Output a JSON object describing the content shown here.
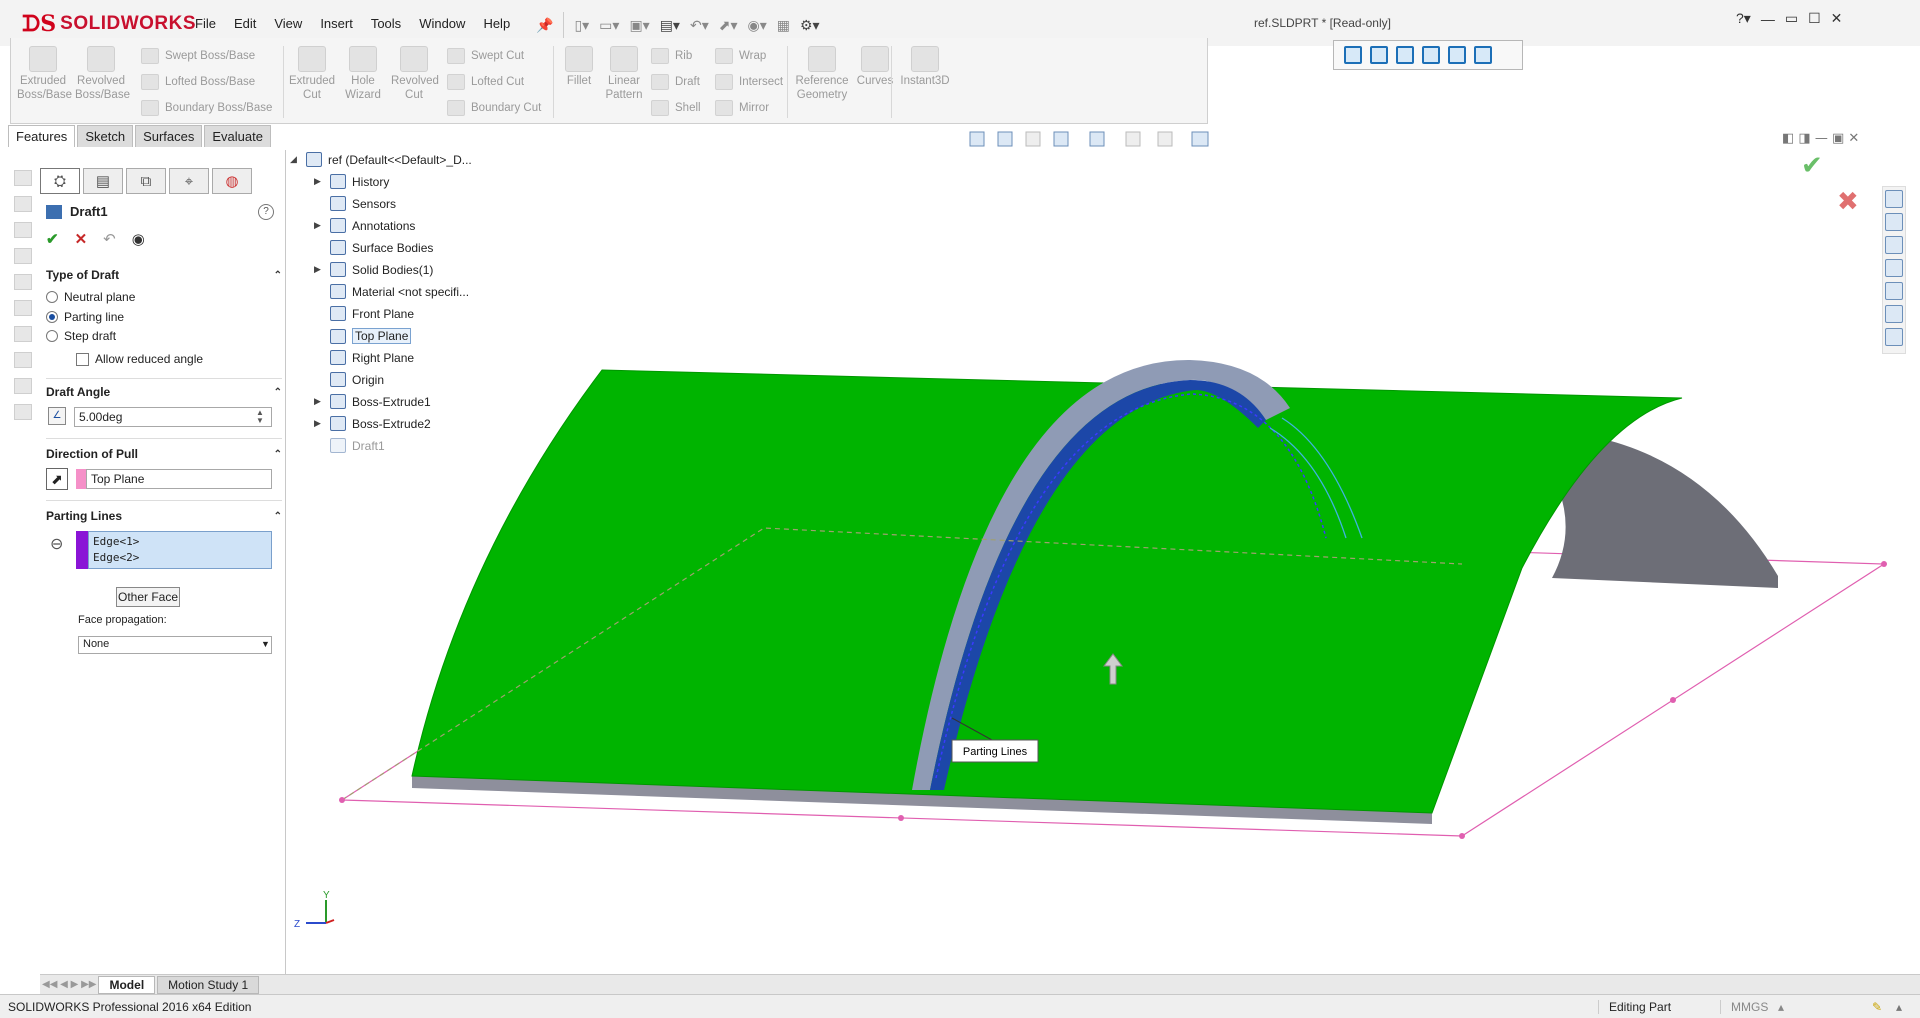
{
  "app": {
    "brand": "SOLIDWORKS",
    "doc_title": "ref.SLDPRT * [Read-only]"
  },
  "menu": [
    "File",
    "Edit",
    "View",
    "Insert",
    "Tools",
    "Window",
    "Help"
  ],
  "ribbon": {
    "buttons": [
      "Extruded Boss/Base",
      "Revolved Boss/Base",
      "Extruded Cut",
      "Hole Wizard",
      "Revolved Cut",
      "Fillet",
      "Linear Pattern",
      "Reference Geometry",
      "Curves",
      "Instant3D"
    ],
    "small": [
      "Swept Boss/Base",
      "Lofted Boss/Base",
      "Boundary Boss/Base",
      "Swept Cut",
      "Lofted Cut",
      "Boundary Cut",
      "Rib",
      "Draft",
      "Shell",
      "Wrap",
      "Intersect",
      "Mirror"
    ]
  },
  "cm_tabs": [
    "Features",
    "Sketch",
    "Surfaces",
    "Evaluate"
  ],
  "pm": {
    "title": "Draft1",
    "type_of_draft": {
      "heading": "Type of Draft",
      "options": [
        "Neutral plane",
        "Parting line",
        "Step draft"
      ],
      "selected": "Parting line",
      "allow_reduced": "Allow reduced angle"
    },
    "draft_angle": {
      "heading": "Draft Angle",
      "value": "5.00deg"
    },
    "direction": {
      "heading": "Direction of Pull",
      "value": "Top Plane"
    },
    "parting": {
      "heading": "Parting Lines",
      "edges": [
        "Edge<1>",
        "Edge<2>"
      ],
      "other_face": "Other Face",
      "face_prop_label": "Face propagation:",
      "face_prop_value": "None"
    }
  },
  "tree": {
    "root": "ref  (Default<<Default>_D...",
    "items": [
      "History",
      "Sensors",
      "Annotations",
      "Surface Bodies",
      "Solid Bodies(1)",
      "Material <not specifi...",
      "Front Plane",
      "Top Plane",
      "Right Plane",
      "Origin",
      "Boss-Extrude1",
      "Boss-Extrude2",
      "Draft1"
    ]
  },
  "viewport": {
    "callout": "Parting Lines",
    "axis_y": "Y",
    "axis_z": "Z"
  },
  "bottom_tabs": [
    "Model",
    "Motion Study 1"
  ],
  "status": {
    "left": "SOLIDWORKS Professional 2016 x64 Edition",
    "mode": "Editing Part",
    "units": "MMGS"
  },
  "colors": {
    "part": "#00b400",
    "side": "#8e8f9c",
    "arch_dark": "#1c47a8",
    "plane": "#e05fb0",
    "accept": "#6abf69",
    "reject": "#e07070"
  }
}
